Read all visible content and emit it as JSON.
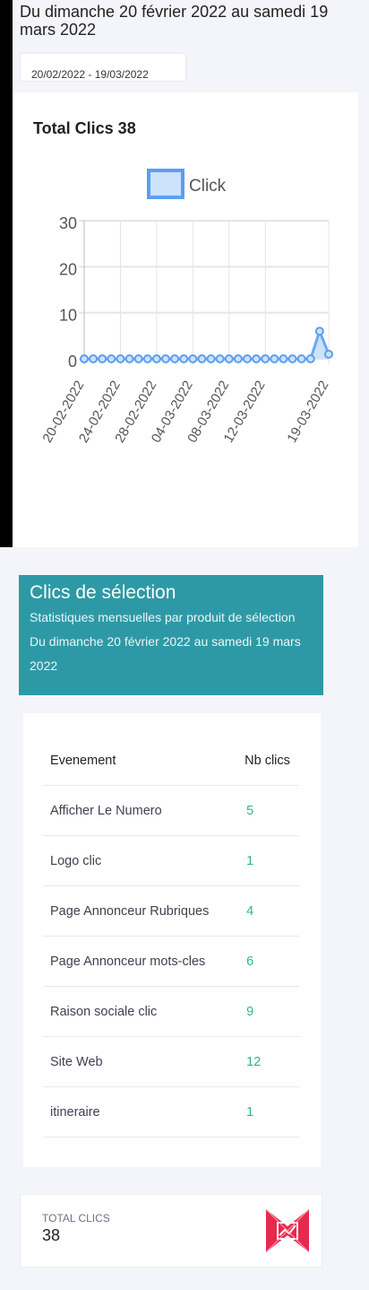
{
  "header": {
    "title": "Du dimanche 20 février 2022 au samedi 19 mars 2022"
  },
  "date_range": {
    "value": "20/02/2022 - 19/03/2022"
  },
  "chart_card": {
    "title": "Total Clics 38"
  },
  "chart_data": {
    "type": "line",
    "title": "",
    "legend": {
      "labels": [
        "Click"
      ],
      "placement": "top"
    },
    "x_tick_labels": [
      "20-02-2022",
      "24-02-2022",
      "28-02-2022",
      "04-03-2022",
      "08-03-2022",
      "12-03-2022",
      "19-03-2022"
    ],
    "x": [
      "20-02-2022",
      "21-02-2022",
      "22-02-2022",
      "23-02-2022",
      "24-02-2022",
      "25-02-2022",
      "26-02-2022",
      "27-02-2022",
      "28-02-2022",
      "01-03-2022",
      "02-03-2022",
      "03-03-2022",
      "04-03-2022",
      "05-03-2022",
      "06-03-2022",
      "07-03-2022",
      "08-03-2022",
      "09-03-2022",
      "10-03-2022",
      "11-03-2022",
      "12-03-2022",
      "13-03-2022",
      "14-03-2022",
      "15-03-2022",
      "16-03-2022",
      "17-03-2022",
      "18-03-2022",
      "19-03-2022"
    ],
    "series": [
      {
        "name": "Click",
        "values": [
          0,
          0,
          0,
          0,
          0,
          0,
          0,
          0,
          0,
          0,
          0,
          0,
          0,
          0,
          0,
          0,
          0,
          0,
          0,
          0,
          0,
          0,
          0,
          0,
          0,
          0,
          6,
          1
        ]
      }
    ],
    "y_ticks": [
      0,
      10,
      20,
      30
    ],
    "ylim": [
      0,
      30
    ],
    "grid": true,
    "colors": {
      "line": "#6aaaf0",
      "fill": "#cde2fb",
      "point_stroke": "#5b9ff0"
    }
  },
  "selection": {
    "title": "Clics de sélection",
    "subtitle": "Statistiques mensuelles par produit de sélection Du dimanche 20 février 2022 au samedi 19 mars 2022"
  },
  "table": {
    "headers": [
      "Evenement",
      "Nb clics"
    ],
    "rows": [
      {
        "event": "Afficher Le Numero",
        "clicks": "5"
      },
      {
        "event": "Logo clic",
        "clicks": "1"
      },
      {
        "event": "Page Annonceur Rubriques",
        "clicks": "4"
      },
      {
        "event": "Page Annonceur mots-cles",
        "clicks": "6"
      },
      {
        "event": "Raison sociale clic",
        "clicks": "9"
      },
      {
        "event": "Site Web",
        "clicks": "12"
      },
      {
        "event": "itineraire",
        "clicks": "1"
      }
    ]
  },
  "total": {
    "label": "TOTAL CLICS",
    "value": "38",
    "icon": "chart-trend-icon",
    "icon_color": "#e8294d"
  }
}
